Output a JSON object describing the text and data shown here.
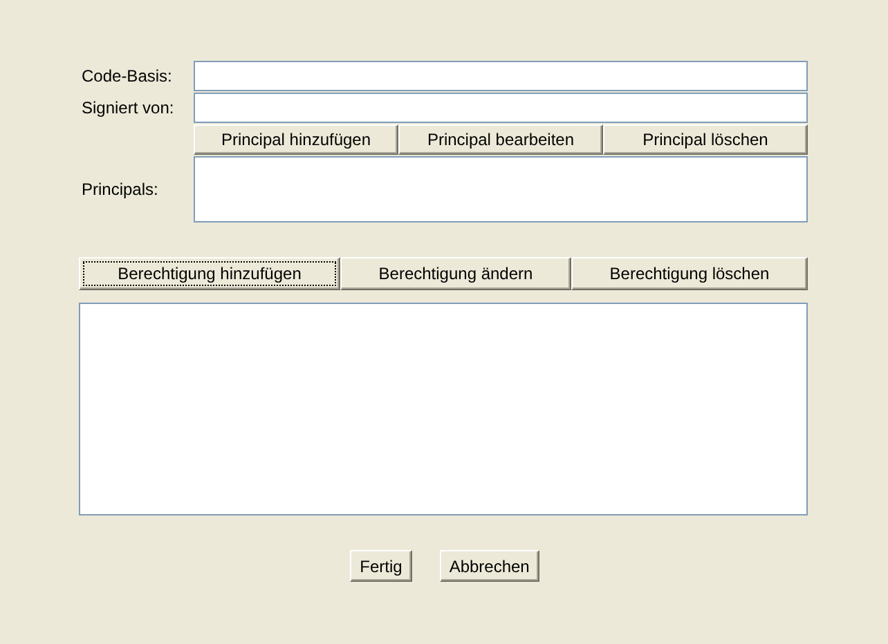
{
  "fields": [
    {
      "label": "Code-Basis:"
    },
    {
      "label": "Signiert von:"
    }
  ],
  "principal_buttons": [
    "Principal hinzufügen",
    "Principal bearbeiten",
    "Principal löschen"
  ],
  "principals": {
    "label": "Principals:"
  },
  "permission_buttons": [
    {
      "label": "Berechtigung hinzufügen",
      "focused": true
    },
    {
      "label": "Berechtigung ändern",
      "focused": false
    },
    {
      "label": "Berechtigung löschen",
      "focused": false
    }
  ],
  "dialog_buttons": [
    "Fertig",
    "Abbrechen"
  ]
}
